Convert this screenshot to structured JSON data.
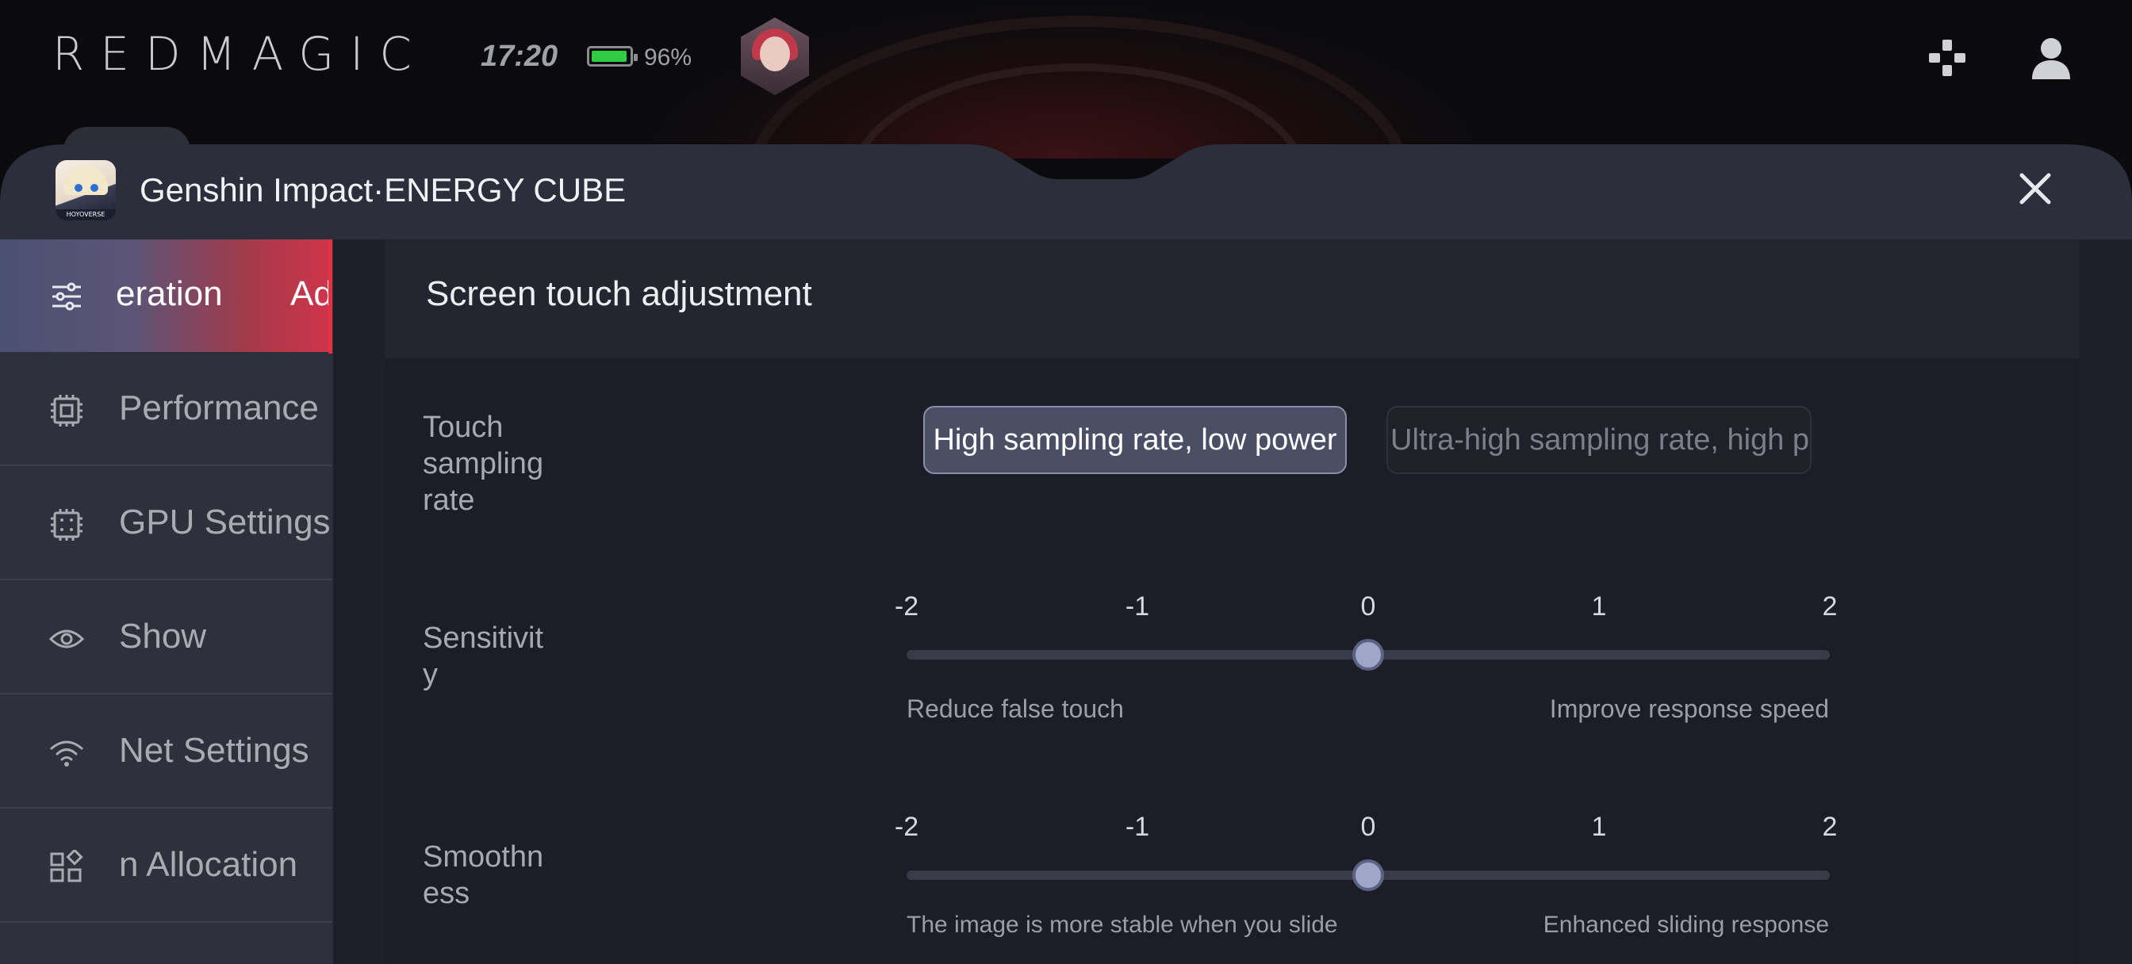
{
  "status_bar": {
    "brand": "REDMAGIC",
    "time": "17:20",
    "battery_percent": "96%",
    "battery_level": 0.96,
    "battery_color": "#2ecc40",
    "icons": [
      "gamepad-icon",
      "user-icon"
    ]
  },
  "panel": {
    "title": "Genshin Impact·ENERGY CUBE",
    "app_icon_caption": "HOYOVERSE",
    "close_icon": "close-icon"
  },
  "sidebar": {
    "items": [
      {
        "label": "eration",
        "label_extra": "Ad",
        "icon": "sliders-icon",
        "active": true
      },
      {
        "label": "Performance",
        "icon": "cpu-icon"
      },
      {
        "label": "GPU Settings",
        "icon": "gpu-chip-icon"
      },
      {
        "label": "Show",
        "icon": "eye-icon"
      },
      {
        "label": "Net Settings",
        "icon": "wifi-icon"
      },
      {
        "label": "n Allocation",
        "icon": "apps-grid-icon"
      }
    ],
    "accent_color": "#e8303f"
  },
  "main": {
    "section_title": "Screen touch adjustment",
    "touch_sampling": {
      "label": "Touch sampling rate",
      "options": [
        {
          "label": "High sampling rate, low power",
          "selected": true
        },
        {
          "label": "Ultra-high sampling rate, high p",
          "selected": false
        }
      ]
    },
    "sensitivity": {
      "label": "Sensitivit y",
      "ticks": [
        "-2",
        "-1",
        "0",
        "1",
        "2"
      ],
      "value": 0,
      "min": -2,
      "max": 2,
      "left_caption": "Reduce false touch",
      "right_caption": "Improve response speed"
    },
    "smoothness": {
      "label": "Smoothn ess",
      "ticks": [
        "-2",
        "-1",
        "0",
        "1",
        "2"
      ],
      "value": 0,
      "min": -2,
      "max": 2,
      "left_caption": "The image is more stable when you slide",
      "right_caption": "Enhanced sliding response"
    }
  }
}
